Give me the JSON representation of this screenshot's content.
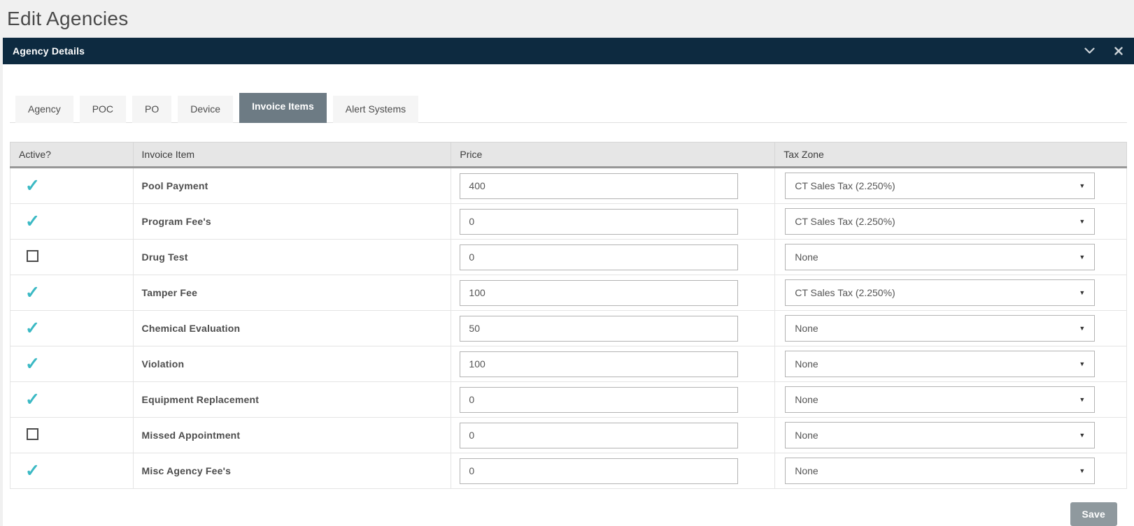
{
  "page": {
    "title": "Edit Agencies"
  },
  "panel": {
    "title": "Agency Details",
    "icons": {
      "collapse": "chevron-down",
      "close": "x"
    }
  },
  "tabs": [
    {
      "label": "Agency",
      "active": false
    },
    {
      "label": "POC",
      "active": false
    },
    {
      "label": "PO",
      "active": false
    },
    {
      "label": "Device",
      "active": false
    },
    {
      "label": "Invoice Items",
      "active": true
    },
    {
      "label": "Alert Systems",
      "active": false
    }
  ],
  "invoice_table": {
    "columns": [
      "Active?",
      "Invoice Item",
      "Price",
      "Tax Zone"
    ],
    "rows": [
      {
        "active": true,
        "item": "Pool Payment",
        "price": "400",
        "tax_zone": "CT Sales Tax (2.250%)"
      },
      {
        "active": true,
        "item": "Program Fee's",
        "price": "0",
        "tax_zone": "CT Sales Tax (2.250%)"
      },
      {
        "active": false,
        "item": "Drug Test",
        "price": "0",
        "tax_zone": "None"
      },
      {
        "active": true,
        "item": "Tamper Fee",
        "price": "100",
        "tax_zone": "CT Sales Tax (2.250%)"
      },
      {
        "active": true,
        "item": "Chemical Evaluation",
        "price": "50",
        "tax_zone": "None"
      },
      {
        "active": true,
        "item": "Violation",
        "price": "100",
        "tax_zone": "None"
      },
      {
        "active": true,
        "item": "Equipment Replacement",
        "price": "0",
        "tax_zone": "None"
      },
      {
        "active": false,
        "item": "Missed Appointment",
        "price": "0",
        "tax_zone": "None"
      },
      {
        "active": true,
        "item": "Misc Agency Fee's",
        "price": "0",
        "tax_zone": "None"
      }
    ]
  },
  "actions": {
    "save_label": "Save"
  },
  "colors": {
    "header_bar": "#0d2a40",
    "active_tab": "#6d7b84",
    "check_mark": "#3bb9c4",
    "save_button": "#8f999e"
  }
}
